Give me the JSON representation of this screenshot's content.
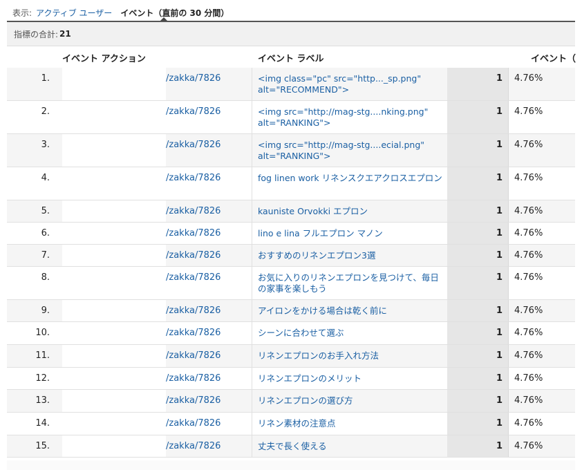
{
  "view": {
    "label": "表示:",
    "option_active_users": "アクティブ ユーザー",
    "option_events": "イベント（直前の 30 分間）"
  },
  "metric_total": {
    "label": "指標の合計:",
    "value": "21"
  },
  "columns": {
    "action": "イベント アクション",
    "label": "イベント ラベル",
    "events": "イベント（"
  },
  "rows": [
    {
      "num": "1.",
      "action": "/zakka/7826",
      "label": "<img class=\"pc\" src=\"http..._sp.png\" alt=\"RECOMMEND\">",
      "count": "1",
      "pct": "4.76%"
    },
    {
      "num": "2.",
      "action": "/zakka/7826",
      "label": "<img src=\"http://mag-stg....nking.png\" alt=\"RANKING\">",
      "count": "1",
      "pct": "4.76%"
    },
    {
      "num": "3.",
      "action": "/zakka/7826",
      "label": "<img src=\"http://mag-stg....ecial.png\" alt=\"RANKING\">",
      "count": "1",
      "pct": "4.76%"
    },
    {
      "num": "4.",
      "action": "/zakka/7826",
      "label": "fog linen work リネンスクエアクロスエプロン",
      "count": "1",
      "pct": "4.76%"
    },
    {
      "num": "5.",
      "action": "/zakka/7826",
      "label": "kauniste Orvokki エプロン",
      "count": "1",
      "pct": "4.76%"
    },
    {
      "num": "6.",
      "action": "/zakka/7826",
      "label": "lino e lina フルエプロン マノン",
      "count": "1",
      "pct": "4.76%"
    },
    {
      "num": "7.",
      "action": "/zakka/7826",
      "label": "おすすめのリネンエプロン3選",
      "count": "1",
      "pct": "4.76%"
    },
    {
      "num": "8.",
      "action": "/zakka/7826",
      "label": "お気に入りのリネンエプロンを見つけて、毎日の家事を楽しもう",
      "count": "1",
      "pct": "4.76%"
    },
    {
      "num": "9.",
      "action": "/zakka/7826",
      "label": "アイロンをかける場合は乾く前に",
      "count": "1",
      "pct": "4.76%"
    },
    {
      "num": "10.",
      "action": "/zakka/7826",
      "label": "シーンに合わせて選ぶ",
      "count": "1",
      "pct": "4.76%"
    },
    {
      "num": "11.",
      "action": "/zakka/7826",
      "label": "リネンエプロンのお手入れ方法",
      "count": "1",
      "pct": "4.76%"
    },
    {
      "num": "12.",
      "action": "/zakka/7826",
      "label": "リネンエプロンのメリット",
      "count": "1",
      "pct": "4.76%"
    },
    {
      "num": "13.",
      "action": "/zakka/7826",
      "label": "リネンエプロンの選び方",
      "count": "1",
      "pct": "4.76%"
    },
    {
      "num": "14.",
      "action": "/zakka/7826",
      "label": "リネン素材の注意点",
      "count": "1",
      "pct": "4.76%"
    },
    {
      "num": "15.",
      "action": "/zakka/7826",
      "label": "丈夫で長く使える",
      "count": "1",
      "pct": "4.76%"
    }
  ]
}
